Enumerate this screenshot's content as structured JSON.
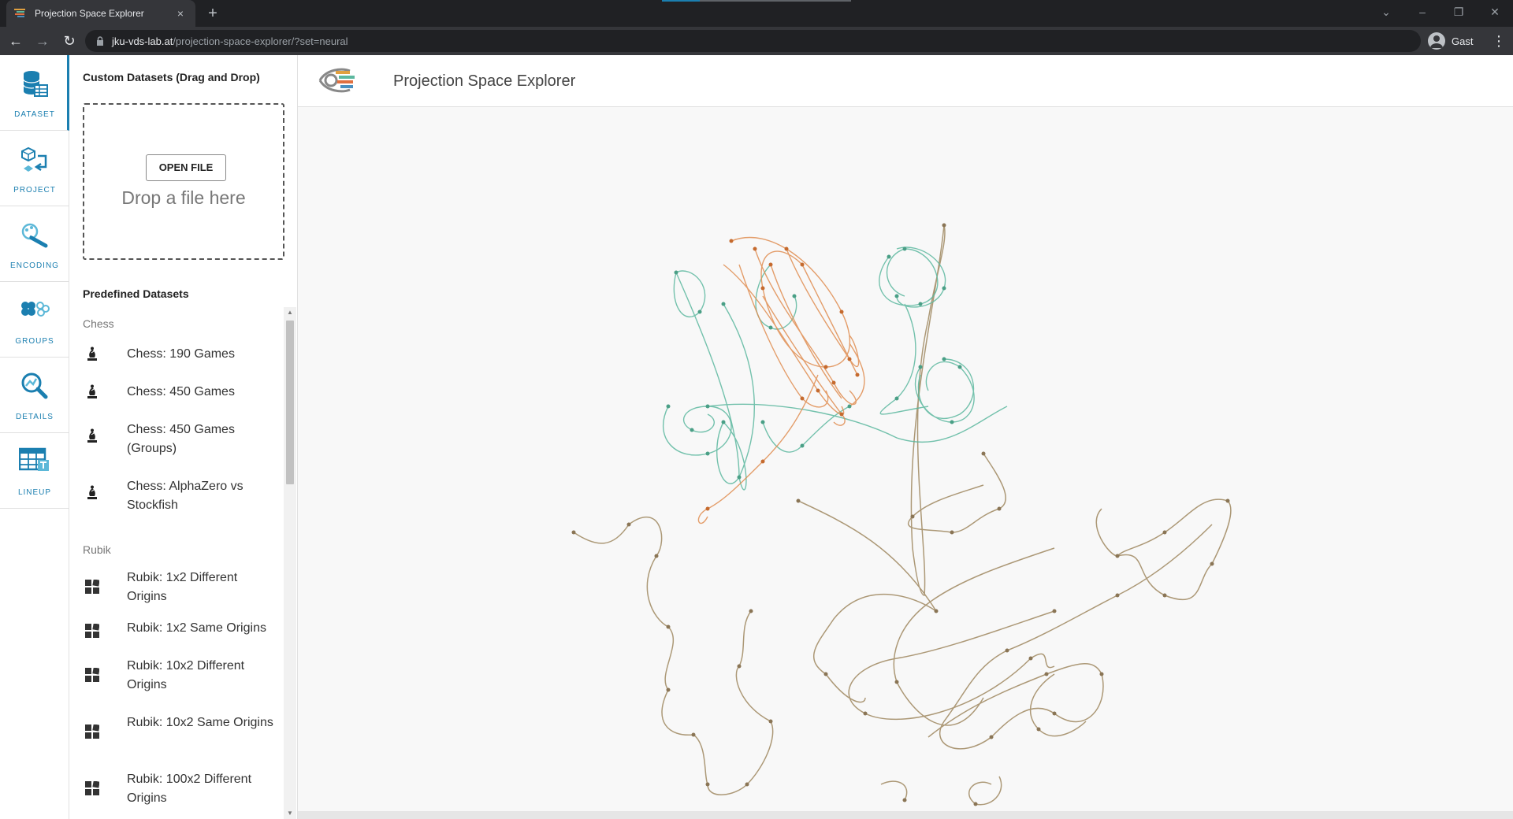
{
  "browser": {
    "tab_title": "Projection Space Explorer",
    "new_tab": "+",
    "close_tab": "×",
    "url_host": "jku-vds-lab.at",
    "url_path": "/projection-space-explorer/?set=neural",
    "profile_name": "Gast",
    "window_controls": [
      "⌄",
      "–",
      "❐",
      "✕"
    ]
  },
  "nav": {
    "items": [
      {
        "label": "DATASET",
        "icon": "dataset-icon",
        "active": true
      },
      {
        "label": "PROJECT",
        "icon": "project-icon",
        "active": false
      },
      {
        "label": "ENCODING",
        "icon": "encoding-icon",
        "active": false
      },
      {
        "label": "GROUPS",
        "icon": "groups-icon",
        "active": false
      },
      {
        "label": "DETAILS",
        "icon": "details-icon",
        "active": false
      },
      {
        "label": "LINEUP",
        "icon": "lineup-icon",
        "active": false
      }
    ]
  },
  "sidebar": {
    "custom_title": "Custom Datasets (Drag and Drop)",
    "open_file": "OPEN FILE",
    "drop_hint": "Drop a file here",
    "predefined_title": "Predefined Datasets",
    "groups": [
      {
        "name": "Chess",
        "icon": "chess-bishop-icon",
        "items": [
          "Chess: 190 Games",
          "Chess: 450 Games",
          "Chess: 450 Games (Groups)",
          "Chess: AlphaZero vs Stockfish"
        ]
      },
      {
        "name": "Rubik",
        "icon": "rubik-cube-icon",
        "items": [
          "Rubik: 1x2 Different Origins",
          "Rubik: 1x2 Same Origins",
          "Rubik: 10x2 Different Origins",
          "Rubik: 10x2 Same Origins",
          "Rubik: 100x2 Different Origins"
        ]
      }
    ]
  },
  "header": {
    "title": "Projection Space Explorer"
  },
  "colors": {
    "accent": "#1b7fb0",
    "teal_series": "#5cb89f",
    "orange_series": "#e08e52",
    "olive_series": "#a89370"
  }
}
